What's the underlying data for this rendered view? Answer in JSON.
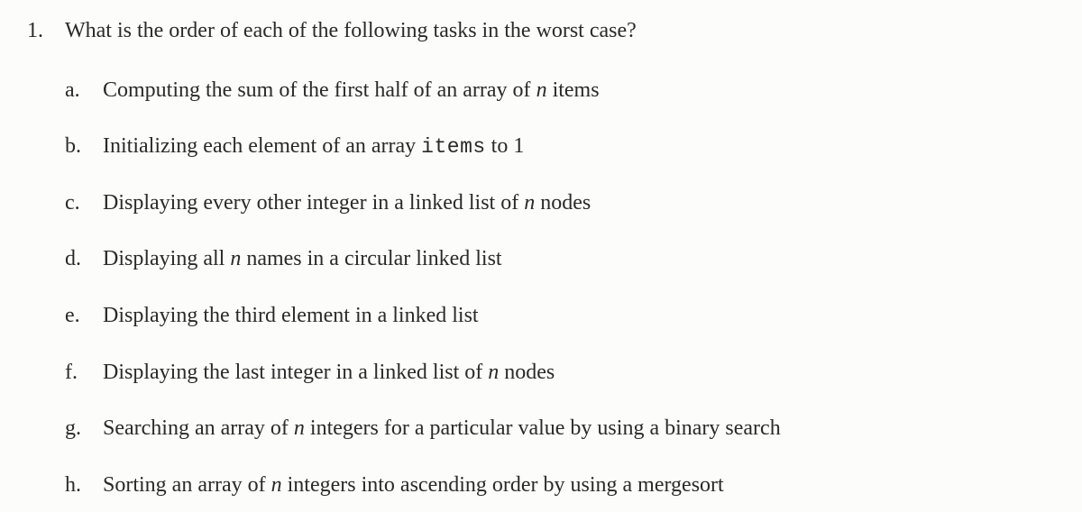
{
  "question": {
    "number": "1.",
    "text": "What is the order of each of the following tasks in the worst case?"
  },
  "items": [
    {
      "label": "a.",
      "pre": "Computing the sum of the first half of an array of ",
      "var": "n",
      "post": " items"
    },
    {
      "label": "b.",
      "pre": "Initializing each element of an array ",
      "code": "items",
      "post2": " to 1"
    },
    {
      "label": "c.",
      "pre": "Displaying every other integer in a linked list of ",
      "var": "n",
      "post": " nodes"
    },
    {
      "label": "d.",
      "pre": "Displaying all ",
      "var": "n",
      "post": " names in a circular linked list"
    },
    {
      "label": "e.",
      "pre": "Displaying the third element in a linked list"
    },
    {
      "label": "f.",
      "pre": "Displaying the last integer in a linked list of ",
      "var": "n",
      "post": " nodes"
    },
    {
      "label": "g.",
      "pre": "Searching an array of ",
      "var": "n",
      "post": " integers for a particular value by using a binary search"
    },
    {
      "label": "h.",
      "pre": "Sorting an array of ",
      "var": "n",
      "post": " integers into ascending order by using a mergesort"
    }
  ]
}
